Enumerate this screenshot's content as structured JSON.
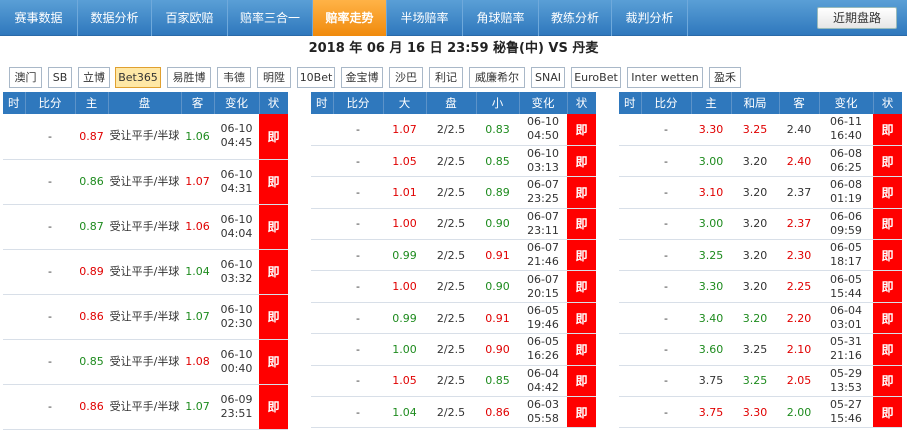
{
  "nav": {
    "tabs": [
      "赛事数据",
      "数据分析",
      "百家欧赔",
      "赔率三合一",
      "赔率走势",
      "半场赔率",
      "角球赔率",
      "教练分析",
      "裁判分析"
    ],
    "active": "赔率走势",
    "recent_button": "近期盘路"
  },
  "match": {
    "title": "2018 年 06 月 16 日 23:59  秘鲁(中)  VS  丹麦"
  },
  "bookmakers": {
    "items": [
      "澳门",
      "SB",
      "立博",
      "Bet365",
      "易胜博",
      "韦德",
      "明陞",
      "10Bet",
      "金宝博",
      "沙巴",
      "利记",
      "威廉希尔",
      "SNAI",
      "EuroBet",
      "Inter wetten",
      "盈禾"
    ],
    "active": "Bet365"
  },
  "colors": {
    "up": "#e00000",
    "down": "#1e8b1e",
    "status": "#ff0000",
    "header": "#2f78bd",
    "active_tab": "#f08a0c"
  },
  "asian": {
    "headers": [
      "时",
      "比分",
      "主",
      "盘",
      "客",
      "变化",
      "状"
    ],
    "rows": [
      {
        "time": "",
        "score": "-",
        "home": "0.87",
        "hc": "red",
        "line": "受让平手/半球",
        "away": "1.06",
        "ac": "green",
        "change": "06-10 04:45",
        "status": "即"
      },
      {
        "time": "",
        "score": "-",
        "home": "0.86",
        "hc": "green",
        "line": "受让平手/半球",
        "away": "1.07",
        "ac": "red",
        "change": "06-10 04:31",
        "status": "即"
      },
      {
        "time": "",
        "score": "-",
        "home": "0.87",
        "hc": "green",
        "line": "受让平手/半球",
        "away": "1.06",
        "ac": "red",
        "change": "06-10 04:04",
        "status": "即"
      },
      {
        "time": "",
        "score": "-",
        "home": "0.89",
        "hc": "red",
        "line": "受让平手/半球",
        "away": "1.04",
        "ac": "green",
        "change": "06-10 03:32",
        "status": "即"
      },
      {
        "time": "",
        "score": "-",
        "home": "0.86",
        "hc": "red",
        "line": "受让平手/半球",
        "away": "1.07",
        "ac": "green",
        "change": "06-10 02:30",
        "status": "即"
      },
      {
        "time": "",
        "score": "-",
        "home": "0.85",
        "hc": "green",
        "line": "受让平手/半球",
        "away": "1.08",
        "ac": "red",
        "change": "06-10 00:40",
        "status": "即"
      },
      {
        "time": "",
        "score": "-",
        "home": "0.86",
        "hc": "red",
        "line": "受让平手/半球",
        "away": "1.07",
        "ac": "green",
        "change": "06-09 23:51",
        "status": "即"
      }
    ]
  },
  "totals": {
    "headers": [
      "时",
      "比分",
      "大",
      "盘",
      "小",
      "变化",
      "状"
    ],
    "rows": [
      {
        "time": "",
        "score": "-",
        "over": "1.07",
        "oc": "red",
        "line": "2/2.5",
        "under": "0.83",
        "uc": "green",
        "change": "06-10 04:50",
        "status": "即"
      },
      {
        "time": "",
        "score": "-",
        "over": "1.05",
        "oc": "red",
        "line": "2/2.5",
        "under": "0.85",
        "uc": "green",
        "change": "06-10 03:13",
        "status": "即"
      },
      {
        "time": "",
        "score": "-",
        "over": "1.01",
        "oc": "red",
        "line": "2/2.5",
        "under": "0.89",
        "uc": "green",
        "change": "06-07 23:25",
        "status": "即"
      },
      {
        "time": "",
        "score": "-",
        "over": "1.00",
        "oc": "red",
        "line": "2/2.5",
        "under": "0.90",
        "uc": "green",
        "change": "06-07 23:11",
        "status": "即"
      },
      {
        "time": "",
        "score": "-",
        "over": "0.99",
        "oc": "green",
        "line": "2/2.5",
        "under": "0.91",
        "uc": "red",
        "change": "06-07 21:46",
        "status": "即"
      },
      {
        "time": "",
        "score": "-",
        "over": "1.00",
        "oc": "red",
        "line": "2/2.5",
        "under": "0.90",
        "uc": "green",
        "change": "06-07 20:15",
        "status": "即"
      },
      {
        "time": "",
        "score": "-",
        "over": "0.99",
        "oc": "green",
        "line": "2/2.5",
        "under": "0.91",
        "uc": "red",
        "change": "06-05 19:46",
        "status": "即"
      },
      {
        "time": "",
        "score": "-",
        "over": "1.00",
        "oc": "green",
        "line": "2/2.5",
        "under": "0.90",
        "uc": "red",
        "change": "06-05 16:26",
        "status": "即"
      },
      {
        "time": "",
        "score": "-",
        "over": "1.05",
        "oc": "red",
        "line": "2/2.5",
        "under": "0.85",
        "uc": "green",
        "change": "06-04 04:42",
        "status": "即"
      },
      {
        "time": "",
        "score": "-",
        "over": "1.04",
        "oc": "green",
        "line": "2/2.5",
        "under": "0.86",
        "uc": "red",
        "change": "06-03 05:58",
        "status": "即"
      }
    ]
  },
  "euro": {
    "headers": [
      "时",
      "比分",
      "主",
      "和局",
      "客",
      "变化",
      "状"
    ],
    "rows": [
      {
        "time": "",
        "score": "-",
        "home": "3.30",
        "hc": "red",
        "draw": "3.25",
        "dc": "red",
        "away": "2.40",
        "ac": "",
        "change": "06-11 16:40",
        "status": "即"
      },
      {
        "time": "",
        "score": "-",
        "home": "3.00",
        "hc": "green",
        "draw": "3.20",
        "dc": "",
        "away": "2.40",
        "ac": "red",
        "change": "06-08 06:25",
        "status": "即"
      },
      {
        "time": "",
        "score": "-",
        "home": "3.10",
        "hc": "red",
        "draw": "3.20",
        "dc": "",
        "away": "2.37",
        "ac": "",
        "change": "06-08 01:19",
        "status": "即"
      },
      {
        "time": "",
        "score": "-",
        "home": "3.00",
        "hc": "green",
        "draw": "3.20",
        "dc": "",
        "away": "2.37",
        "ac": "red",
        "change": "06-06 09:59",
        "status": "即"
      },
      {
        "time": "",
        "score": "-",
        "home": "3.25",
        "hc": "green",
        "draw": "3.20",
        "dc": "",
        "away": "2.30",
        "ac": "red",
        "change": "06-05 18:17",
        "status": "即"
      },
      {
        "time": "",
        "score": "-",
        "home": "3.30",
        "hc": "green",
        "draw": "3.20",
        "dc": "",
        "away": "2.25",
        "ac": "red",
        "change": "06-05 15:44",
        "status": "即"
      },
      {
        "time": "",
        "score": "-",
        "home": "3.40",
        "hc": "green",
        "draw": "3.20",
        "dc": "green",
        "away": "2.20",
        "ac": "red",
        "change": "06-04 03:01",
        "status": "即"
      },
      {
        "time": "",
        "score": "-",
        "home": "3.60",
        "hc": "green",
        "draw": "3.25",
        "dc": "",
        "away": "2.10",
        "ac": "red",
        "change": "05-31 21:16",
        "status": "即"
      },
      {
        "time": "",
        "score": "-",
        "home": "3.75",
        "hc": "",
        "draw": "3.25",
        "dc": "green",
        "away": "2.05",
        "ac": "red",
        "change": "05-29 13:53",
        "status": "即"
      },
      {
        "time": "",
        "score": "-",
        "home": "3.75",
        "hc": "red",
        "draw": "3.30",
        "dc": "red",
        "away": "2.00",
        "ac": "green",
        "change": "05-27 15:46",
        "status": "即"
      }
    ]
  }
}
